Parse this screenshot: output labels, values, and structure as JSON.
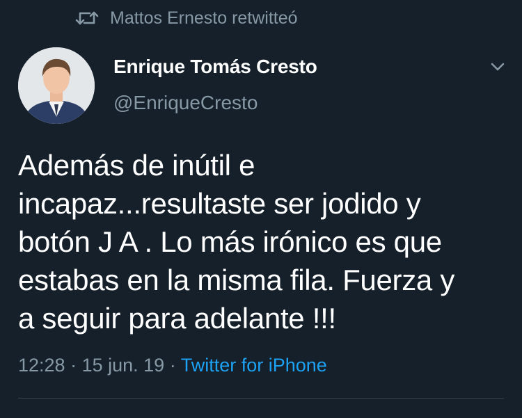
{
  "retweet": {
    "icon": "retweet-icon",
    "text": "Mattos Ernesto retwitteó"
  },
  "author": {
    "avatar_icon": "avatar",
    "display_name": "Enrique Tomás Cresto",
    "handle": "@EnriqueCresto"
  },
  "menu": {
    "icon": "chevron-down-icon"
  },
  "tweet": {
    "lines": [
      "Además de inútil e",
      "incapaz...resultaste ser jodido y",
      "botón J A . Lo más irónico es que",
      "estabas en la misma fila. Fuerza y",
      "a seguir para adelante !!!"
    ]
  },
  "meta": {
    "time": "12:28",
    "separator": " · ",
    "date": "15 jun. 19",
    "source": "Twitter for iPhone"
  },
  "colors": {
    "background": "#15202b",
    "text": "#ffffff",
    "secondary": "#8899a6",
    "link": "#1da1f2",
    "divider": "#38444d"
  }
}
